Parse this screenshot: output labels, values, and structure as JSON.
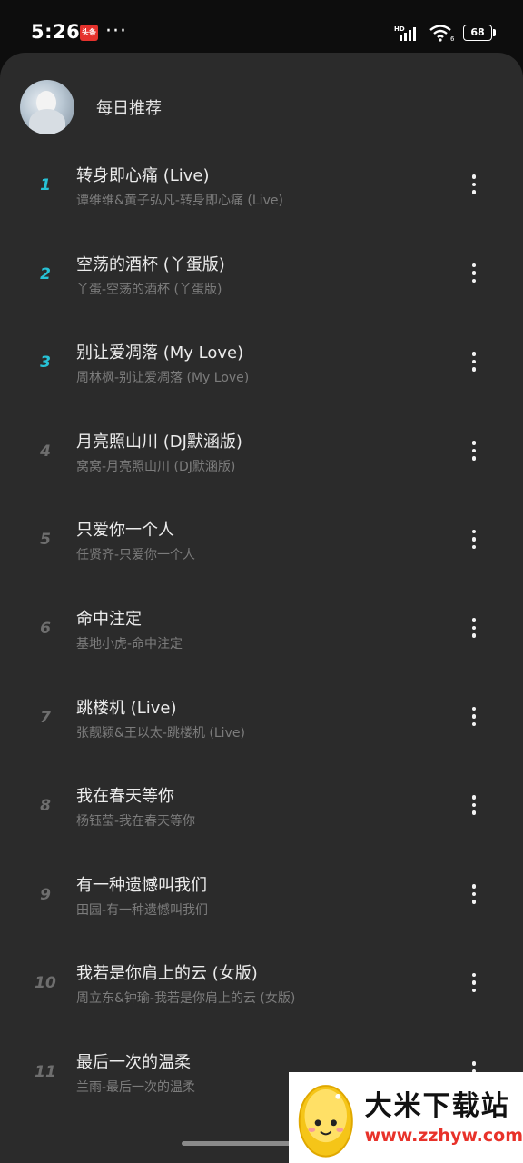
{
  "status_bar": {
    "time": "5:26",
    "app_badge": "头条",
    "more": "···",
    "network": "HD",
    "wifi_sub": "6",
    "battery": "68"
  },
  "header": {
    "title": "每日推荐"
  },
  "colors": {
    "accent": "#27c2d6",
    "sheet_background": "#2b2b2b",
    "title_text": "#ececec",
    "subtitle_text": "#7c7c7c",
    "watermark_url": "#e8322a"
  },
  "songs": [
    {
      "index": "1",
      "title": "转身即心痛 (Live)",
      "subtitle": "谭维维&黄子弘凡-转身即心痛 (Live)"
    },
    {
      "index": "2",
      "title": "空荡的酒杯 (丫蛋版)",
      "subtitle": "丫蛋-空荡的酒杯 (丫蛋版)"
    },
    {
      "index": "3",
      "title": "别让爱凋落 (My Love)",
      "subtitle": "周林枫-别让爱凋落 (My Love)"
    },
    {
      "index": "4",
      "title": "月亮照山川 (DJ默涵版)",
      "subtitle": "窝窝-月亮照山川 (DJ默涵版)"
    },
    {
      "index": "5",
      "title": "只爱你一个人",
      "subtitle": "任贤齐-只爱你一个人"
    },
    {
      "index": "6",
      "title": "命中注定",
      "subtitle": "基地小虎-命中注定"
    },
    {
      "index": "7",
      "title": "跳楼机 (Live)",
      "subtitle": "张靓颖&王以太-跳楼机 (Live)"
    },
    {
      "index": "8",
      "title": "我在春天等你",
      "subtitle": "杨钰莹-我在春天等你"
    },
    {
      "index": "9",
      "title": "有一种遗憾叫我们",
      "subtitle": "田园-有一种遗憾叫我们"
    },
    {
      "index": "10",
      "title": "我若是你肩上的云 (女版)",
      "subtitle": "周立东&钟瑜-我若是你肩上的云 (女版)"
    },
    {
      "index": "11",
      "title": "最后一次的温柔",
      "subtitle": "兰雨-最后一次的温柔"
    }
  ],
  "watermark": {
    "brand": "大米下载站",
    "url": "www.zzhyw.com"
  }
}
